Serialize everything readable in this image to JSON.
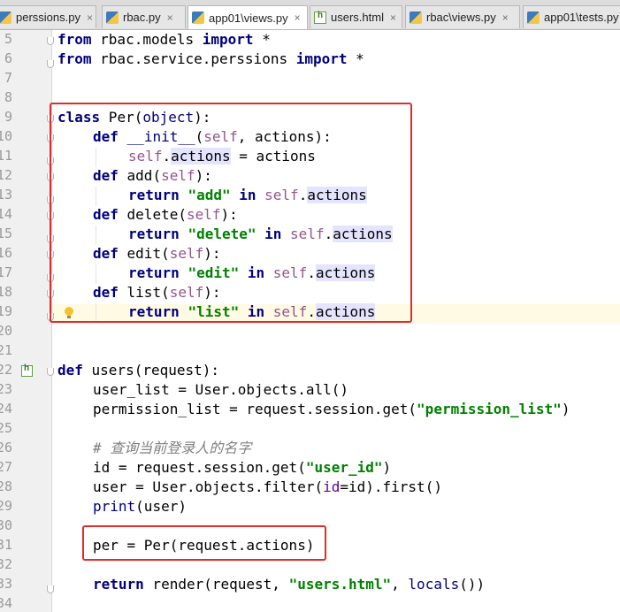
{
  "tabs": [
    {
      "label": "perssions.py",
      "icon": "python-file-icon"
    },
    {
      "label": "rbac.py",
      "icon": "python-file-icon"
    },
    {
      "label": "app01\\views.py",
      "icon": "python-file-icon",
      "active": true
    },
    {
      "label": "users.html",
      "icon": "html-file-icon"
    },
    {
      "label": "rbac\\views.py",
      "icon": "python-file-icon"
    },
    {
      "label": "app01\\tests.py",
      "icon": "python-file-icon"
    }
  ],
  "close_glyph": "×",
  "line_numbers": [
    "5",
    "6",
    "7",
    "8",
    "9",
    "10",
    "11",
    "12",
    "13",
    "14",
    "15",
    "16",
    "17",
    "18",
    "19",
    "20",
    "21",
    "22",
    "23",
    "24",
    "25",
    "26",
    "27",
    "28",
    "29",
    "30",
    "31",
    "32",
    "33",
    "34"
  ],
  "code": {
    "l5": {
      "k1": "from",
      "t1": " rbac.models ",
      "k2": "import",
      "t2": " *"
    },
    "l6": {
      "k1": "from",
      "t1": " rbac.service.perssions ",
      "k2": "import",
      "t2": " *"
    },
    "l9": {
      "k1": "class",
      "t1": " Per(",
      "b1": "object",
      "t2": "):"
    },
    "l10": {
      "k1": "def",
      "t1": " ",
      "m1": "__init__",
      "t2": "(",
      "sf1": "self",
      "t3": ", actions):"
    },
    "l11": {
      "sf1": "self",
      "t1": ".",
      "h1": "actions",
      "t2": " = actions"
    },
    "l12": {
      "k1": "def",
      "t1": " add(",
      "sf1": "self",
      "t2": "):"
    },
    "l13": {
      "k1": "return",
      "t1": " ",
      "s1": "\"add\"",
      "t2": " ",
      "k2": "in",
      "t3": " ",
      "sf1": "self",
      "t4": ".",
      "h1": "actions"
    },
    "l14": {
      "k1": "def",
      "t1": " delete(",
      "sf1": "self",
      "t2": "):"
    },
    "l15": {
      "k1": "return",
      "t1": " ",
      "s1": "\"delete\"",
      "t2": " ",
      "k2": "in",
      "t3": " ",
      "sf1": "self",
      "t4": ".",
      "h1": "actions"
    },
    "l16": {
      "k1": "def",
      "t1": " edit(",
      "sf1": "self",
      "t2": "):"
    },
    "l17": {
      "k1": "return",
      "t1": " ",
      "s1": "\"edit\"",
      "t2": " ",
      "k2": "in",
      "t3": " ",
      "sf1": "self",
      "t4": ".",
      "h1": "actions"
    },
    "l18": {
      "k1": "def",
      "t1": " list(",
      "sf1": "self",
      "t2": "):"
    },
    "l19": {
      "k1": "return",
      "t1": " ",
      "s1": "\"list\"",
      "t2": " ",
      "k2": "in",
      "t3": " ",
      "sf1": "self",
      "t4": ".",
      "h1": "actions"
    },
    "l22": {
      "k1": "def",
      "t1": " users(request):"
    },
    "l23": {
      "t1": "user_list = User.objects.all()"
    },
    "l24": {
      "t1": "permission_list = request.session.get(",
      "s1": "\"permission_list\"",
      "t2": ")"
    },
    "l26": {
      "c1": "# 查询当前登录人的名字"
    },
    "l27": {
      "t1": "id = request.session.get(",
      "s1": "\"user_id\"",
      "t2": ")"
    },
    "l28": {
      "t1": "user = User.objects.filter(",
      "kw1": "id",
      "t2": "=id).first()"
    },
    "l29": {
      "b1": "print",
      "t1": "(user)"
    },
    "l31": {
      "t1": "per = Per(request.actions)"
    },
    "l33": {
      "k1": "return",
      "t1": " render(request, ",
      "s1": "\"users.html\"",
      "t2": ", ",
      "b1": "locals",
      "t3": "())"
    }
  },
  "colors": {
    "highlight_box": "#e22b2b",
    "keyword": "#000080",
    "string": "#008000",
    "self": "#94558d",
    "comment": "#808080"
  }
}
